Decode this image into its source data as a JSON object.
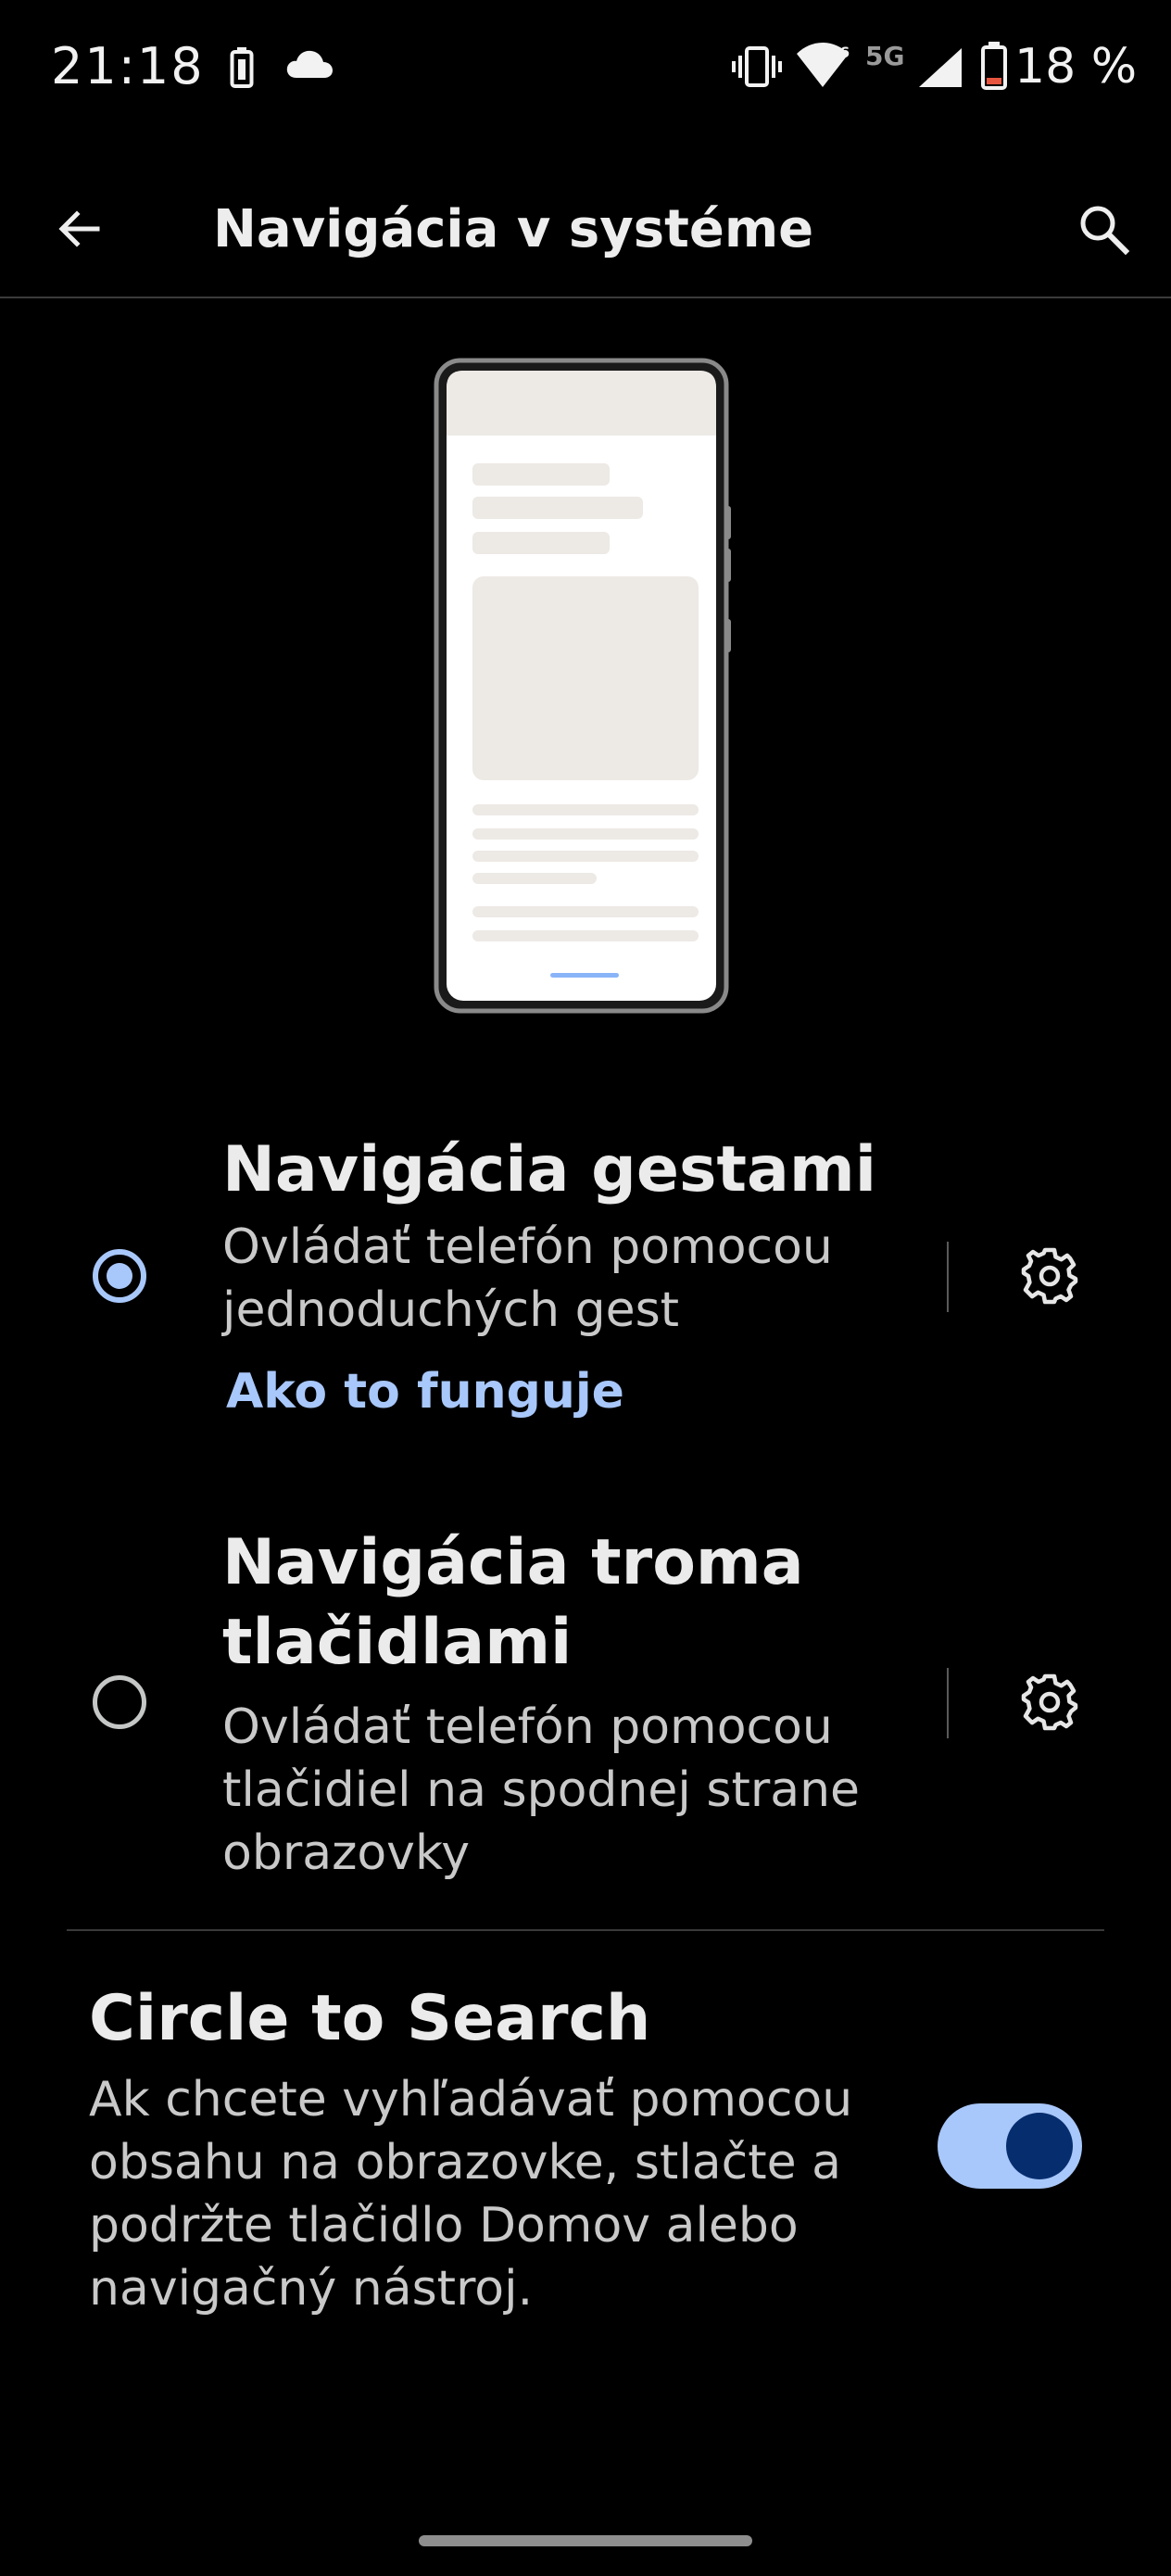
{
  "status_bar": {
    "time": "21:18",
    "network": "5G",
    "battery": "18 %",
    "icons": [
      "battery-saver-icon",
      "cloud-icon",
      "vibrate-icon",
      "wifi-icon",
      "cellular-signal-icon",
      "battery-icon"
    ],
    "battery_low_color": "#e8553f"
  },
  "app_bar": {
    "title": "Navigácia v systéme",
    "back_icon": "arrow-back-icon",
    "search_icon": "search-icon"
  },
  "options": [
    {
      "title": "Navigácia gestami",
      "summary": "Ovládať telefón pomocou jednoduchých gest",
      "link": "Ako to funguje",
      "selected": true
    },
    {
      "title": "Navigácia troma tlačidlami",
      "summary": "Ovládať telefón pomocou tlačidiel na spodnej strane obrazovky",
      "selected": false
    }
  ],
  "circle_to_search": {
    "title": "Circle to Search",
    "summary": "Ak chcete vyhľadávať pomocou obsahu na obrazovke, stlačte a podržte tlačidlo Domov alebo navigačný nástroj.",
    "enabled": true
  },
  "colors": {
    "accent": "#a8c7fa",
    "toggle_thumb": "#062e6f",
    "background": "#000000"
  }
}
